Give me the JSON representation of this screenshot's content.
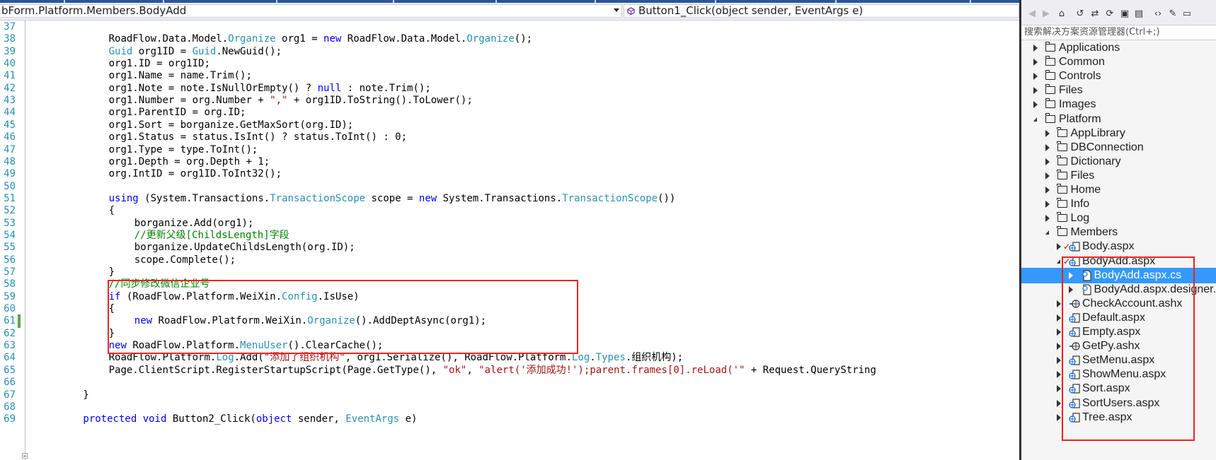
{
  "navbar": {
    "type_selector": "bForm.Platform.Members.BodyAdd",
    "member_selector": "Button1_Click(object sender, EventArgs e)"
  },
  "editor": {
    "lines": [
      {
        "n": "37",
        "indent": 0,
        "tokens": []
      },
      {
        "n": "38",
        "indent": 12,
        "tokens": [
          [
            "p",
            "RoadFlow.Data.Model."
          ],
          [
            "t",
            "Organize"
          ],
          [
            "p",
            " org1 = "
          ],
          [
            "k",
            "new"
          ],
          [
            "p",
            " RoadFlow.Data.Model."
          ],
          [
            "t",
            "Organize"
          ],
          [
            "p",
            "();"
          ]
        ]
      },
      {
        "n": "39",
        "indent": 12,
        "tokens": [
          [
            "t",
            "Guid"
          ],
          [
            "p",
            " org1ID = "
          ],
          [
            "t",
            "Guid"
          ],
          [
            "p",
            ".NewGuid();"
          ]
        ]
      },
      {
        "n": "40",
        "indent": 12,
        "tokens": [
          [
            "p",
            "org1.ID = org1ID;"
          ]
        ]
      },
      {
        "n": "41",
        "indent": 12,
        "tokens": [
          [
            "p",
            "org1.Name = name.Trim();"
          ]
        ]
      },
      {
        "n": "42",
        "indent": 12,
        "tokens": [
          [
            "p",
            "org1.Note = note.IsNullOrEmpty() ? "
          ],
          [
            "k",
            "null"
          ],
          [
            "p",
            " : note.Trim();"
          ]
        ]
      },
      {
        "n": "43",
        "indent": 12,
        "tokens": [
          [
            "p",
            "org1.Number = org.Number + "
          ],
          [
            "s",
            "\",\""
          ],
          [
            "p",
            " + org1ID.ToString().ToLower();"
          ]
        ]
      },
      {
        "n": "44",
        "indent": 12,
        "tokens": [
          [
            "p",
            "org1.ParentID = org.ID;"
          ]
        ]
      },
      {
        "n": "45",
        "indent": 12,
        "tokens": [
          [
            "p",
            "org1.Sort = borganize.GetMaxSort(org.ID);"
          ]
        ]
      },
      {
        "n": "46",
        "indent": 12,
        "tokens": [
          [
            "p",
            "org1.Status = status.IsInt() ? status.ToInt() : 0;"
          ]
        ]
      },
      {
        "n": "47",
        "indent": 12,
        "tokens": [
          [
            "p",
            "org1.Type = type.ToInt();"
          ]
        ]
      },
      {
        "n": "48",
        "indent": 12,
        "tokens": [
          [
            "p",
            "org1.Depth = org.Depth + 1;"
          ]
        ]
      },
      {
        "n": "49",
        "indent": 12,
        "tokens": [
          [
            "p",
            "org.IntID = org1ID.ToInt32();"
          ]
        ]
      },
      {
        "n": "50",
        "indent": 0,
        "tokens": []
      },
      {
        "n": "51",
        "indent": 12,
        "tokens": [
          [
            "k",
            "using"
          ],
          [
            "p",
            " (System.Transactions."
          ],
          [
            "t",
            "TransactionScope"
          ],
          [
            "p",
            " scope = "
          ],
          [
            "k",
            "new"
          ],
          [
            "p",
            " System.Transactions."
          ],
          [
            "t",
            "TransactionScope"
          ],
          [
            "p",
            "())"
          ]
        ]
      },
      {
        "n": "52",
        "indent": 12,
        "tokens": [
          [
            "p",
            "{"
          ]
        ]
      },
      {
        "n": "53",
        "indent": 16,
        "tokens": [
          [
            "p",
            "borganize.Add(org1);"
          ]
        ]
      },
      {
        "n": "54",
        "indent": 16,
        "tokens": [
          [
            "c",
            "//更新父级[ChildsLength]字段"
          ]
        ]
      },
      {
        "n": "55",
        "indent": 16,
        "tokens": [
          [
            "p",
            "borganize.UpdateChildsLength(org.ID);"
          ]
        ]
      },
      {
        "n": "56",
        "indent": 16,
        "tokens": [
          [
            "p",
            "scope.Complete();"
          ]
        ]
      },
      {
        "n": "57",
        "indent": 12,
        "tokens": [
          [
            "p",
            "}"
          ]
        ]
      },
      {
        "n": "58",
        "indent": 12,
        "tokens": [
          [
            "c",
            "//同步修改微信企业号"
          ]
        ]
      },
      {
        "n": "59",
        "indent": 12,
        "tokens": [
          [
            "k",
            "if"
          ],
          [
            "p",
            " (RoadFlow.Platform.WeiXin."
          ],
          [
            "t",
            "Config"
          ],
          [
            "p",
            ".IsUse)"
          ]
        ]
      },
      {
        "n": "60",
        "indent": 12,
        "tokens": [
          [
            "p",
            "{"
          ]
        ]
      },
      {
        "n": "61",
        "indent": 16,
        "tokens": [
          [
            "k",
            "new"
          ],
          [
            "p",
            " RoadFlow.Platform.WeiXin."
          ],
          [
            "t",
            "Organize"
          ],
          [
            "p",
            "().AddDeptAsync(org1);"
          ]
        ]
      },
      {
        "n": "62",
        "indent": 12,
        "tokens": [
          [
            "p",
            "}"
          ]
        ]
      },
      {
        "n": "63",
        "indent": 12,
        "tokens": [
          [
            "k",
            "new"
          ],
          [
            "p",
            " RoadFlow.Platform."
          ],
          [
            "t",
            "MenuUser"
          ],
          [
            "p",
            "().ClearCache();"
          ]
        ]
      },
      {
        "n": "64",
        "indent": 12,
        "tokens": [
          [
            "p",
            "RoadFlow.Platform."
          ],
          [
            "t",
            "Log"
          ],
          [
            "p",
            ".Add("
          ],
          [
            "s",
            "\"添加了组织机构\""
          ],
          [
            "p",
            ", org1.Serialize(), RoadFlow.Platform."
          ],
          [
            "t",
            "Log"
          ],
          [
            "p",
            "."
          ],
          [
            "t",
            "Types"
          ],
          [
            "p",
            ".组织机构);"
          ]
        ]
      },
      {
        "n": "65",
        "indent": 12,
        "tokens": [
          [
            "p",
            "Page.ClientScript.RegisterStartupScript(Page.GetType(), "
          ],
          [
            "s",
            "\"ok\""
          ],
          [
            "p",
            ", "
          ],
          [
            "s",
            "\"alert('添加成功!');parent.frames[0].reLoad('\""
          ],
          [
            "p",
            " + Request.QueryString"
          ]
        ]
      },
      {
        "n": "66",
        "indent": 0,
        "tokens": []
      },
      {
        "n": "67",
        "indent": 8,
        "tokens": [
          [
            "p",
            "}"
          ]
        ]
      },
      {
        "n": "68",
        "indent": 0,
        "tokens": []
      },
      {
        "n": "69",
        "indent": 8,
        "tokens": [
          [
            "k",
            "protected"
          ],
          [
            "p",
            " "
          ],
          [
            "k",
            "void"
          ],
          [
            "p",
            " Button2_Click("
          ],
          [
            "k",
            "object"
          ],
          [
            "p",
            " sender, "
          ],
          [
            "t",
            "EventArgs"
          ],
          [
            "p",
            " e)"
          ]
        ]
      }
    ],
    "modified_line": "61"
  },
  "solution_explorer": {
    "search_placeholder": "搜索解决方案资源管理器(Ctrl+;)",
    "nodes": [
      {
        "label": "Applications",
        "level": 0,
        "kind": "folder",
        "state": "collapsed"
      },
      {
        "label": "Common",
        "level": 0,
        "kind": "folder",
        "state": "collapsed"
      },
      {
        "label": "Controls",
        "level": 0,
        "kind": "folder",
        "state": "collapsed"
      },
      {
        "label": "Files",
        "level": 0,
        "kind": "folder",
        "state": "collapsed"
      },
      {
        "label": "Images",
        "level": 0,
        "kind": "folder",
        "state": "collapsed"
      },
      {
        "label": "Platform",
        "level": 0,
        "kind": "folder",
        "state": "expanded"
      },
      {
        "label": "AppLibrary",
        "level": 1,
        "kind": "folder",
        "state": "collapsed"
      },
      {
        "label": "DBConnection",
        "level": 1,
        "kind": "folder",
        "state": "collapsed"
      },
      {
        "label": "Dictionary",
        "level": 1,
        "kind": "folder",
        "state": "collapsed"
      },
      {
        "label": "Files",
        "level": 1,
        "kind": "folder",
        "state": "collapsed"
      },
      {
        "label": "Home",
        "level": 1,
        "kind": "folder",
        "state": "collapsed"
      },
      {
        "label": "Info",
        "level": 1,
        "kind": "folder",
        "state": "collapsed"
      },
      {
        "label": "Log",
        "level": 1,
        "kind": "folder",
        "state": "collapsed"
      },
      {
        "label": "Members",
        "level": 1,
        "kind": "folder",
        "state": "expanded"
      },
      {
        "label": "Body.aspx",
        "level": 2,
        "kind": "page",
        "state": "collapsed",
        "checked": true
      },
      {
        "label": "BodyAdd.aspx",
        "level": 2,
        "kind": "page",
        "state": "expanded",
        "checked": true
      },
      {
        "label": "BodyAdd.aspx.cs",
        "level": 3,
        "kind": "code",
        "state": "collapsed",
        "selected": true
      },
      {
        "label": "BodyAdd.aspx.designer.cs",
        "level": 3,
        "kind": "code",
        "state": "collapsed"
      },
      {
        "label": "CheckAccount.ashx",
        "level": 2,
        "kind": "handler",
        "state": "collapsed"
      },
      {
        "label": "Default.aspx",
        "level": 2,
        "kind": "page",
        "state": "collapsed"
      },
      {
        "label": "Empty.aspx",
        "level": 2,
        "kind": "page",
        "state": "collapsed"
      },
      {
        "label": "GetPy.ashx",
        "level": 2,
        "kind": "handler",
        "state": "collapsed"
      },
      {
        "label": "SetMenu.aspx",
        "level": 2,
        "kind": "page",
        "state": "collapsed"
      },
      {
        "label": "ShowMenu.aspx",
        "level": 2,
        "kind": "page",
        "state": "collapsed"
      },
      {
        "label": "Sort.aspx",
        "level": 2,
        "kind": "page",
        "state": "collapsed"
      },
      {
        "label": "SortUsers.aspx",
        "level": 2,
        "kind": "page",
        "state": "collapsed"
      },
      {
        "label": "Tree.aspx",
        "level": 2,
        "kind": "page",
        "state": "collapsed"
      }
    ]
  },
  "colors": {
    "keyword": "#0000ff",
    "type": "#2b91af",
    "string": "#a31515",
    "comment": "#008000",
    "selection": "#3399ff",
    "annotation": "#ee2222"
  }
}
